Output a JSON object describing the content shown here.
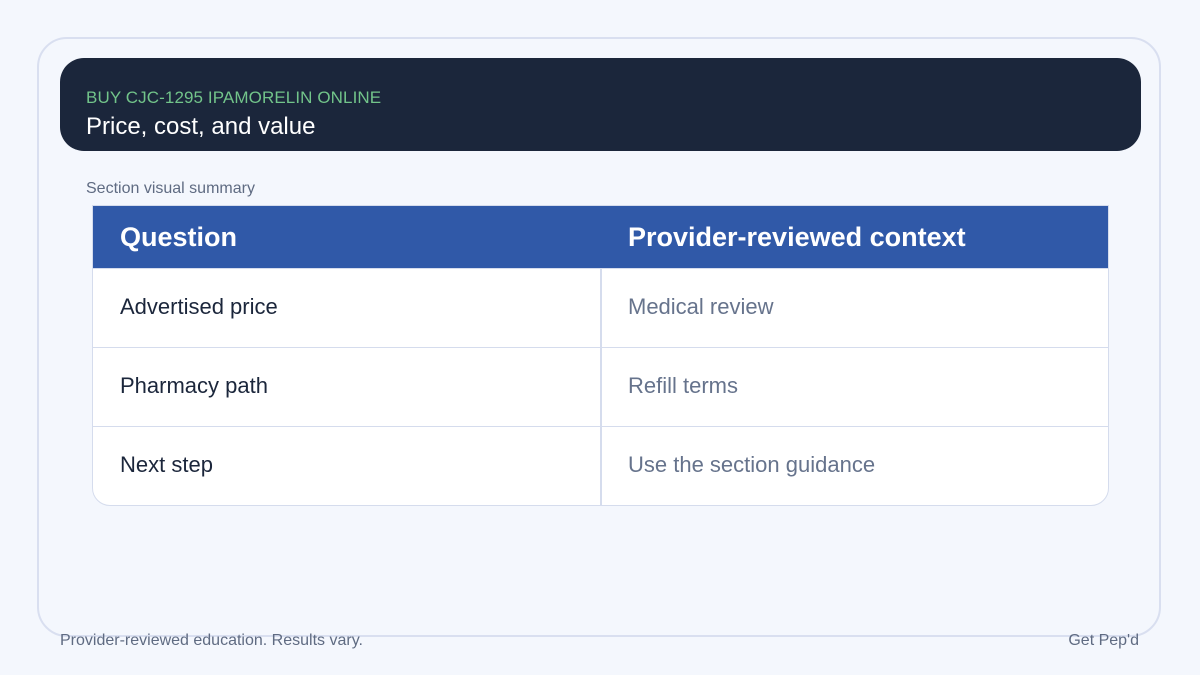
{
  "header": {
    "eyebrow": "BUY CJC-1295 IPAMORELIN ONLINE",
    "title": "Price, cost, and value"
  },
  "section_caption": "Section visual summary",
  "table": {
    "columns": [
      "Question",
      "Provider-reviewed context"
    ],
    "rows": [
      [
        "Advertised price",
        "Medical review"
      ],
      [
        "Pharmacy path",
        "Refill terms"
      ],
      [
        "Next step",
        "Use the section guidance"
      ]
    ]
  },
  "footer": {
    "left": "Provider-reviewed education. Results vary.",
    "right": "Get Pep'd"
  },
  "colors": {
    "header_bg": "#1b263b",
    "eyebrow": "#72c48a",
    "table_header_bg": "#3059a8",
    "page_bg": "#f4f7fd"
  }
}
